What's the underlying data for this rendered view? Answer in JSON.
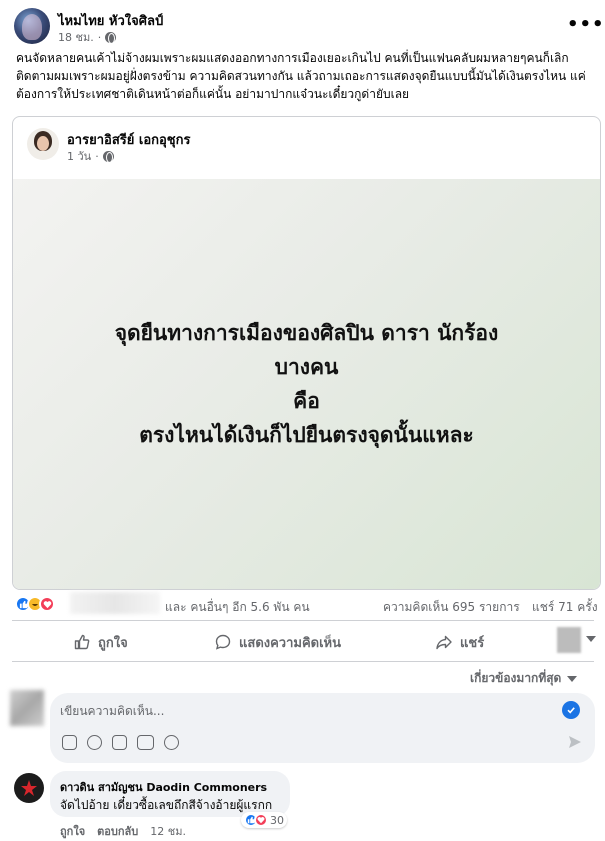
{
  "post": {
    "author": "ไหมไทย หัวใจศิลป์",
    "time": "18 ชม.",
    "more_label": "•••",
    "caption": "คนจัดหลายคนเค้าไม่จ้างผมเพราะผมแสดงออกทางการเมืองเยอะเกินไป คนที่เป็นแฟนคลับผมหลายๆคนก็เลิกติดตามผมเพราะผมอยู่ฝั่งตรงข้าม ความคิดสวนทางกัน แล้วถามเถอะการแสดงจุดยืนแบบนี้มันได้เงินตรงไหน แค่ต้องการให้ประเทศชาติเดินหน้าต่อก็แค่นั้น อย่ามาปากแจ๋วนะเดี๋ยวกูด่ายับเลย"
  },
  "shared": {
    "author": "อารยาอิสรีย์ เอกอุชุกร",
    "time": "1 วัน",
    "quote_lines": [
      "จุดยืนทางการเมืองของศิลปิน ดารา นักร้อง",
      "บางคน",
      "คือ",
      "ตรงไหนได้เงินก็ไปยืนตรงจุดนั้นแหละ"
    ]
  },
  "stats": {
    "reactions_text": "และ คนอื่นๆ อีก 5.6 พัน คน",
    "comments": "ความคิดเห็น 695 รายการ",
    "shares": "แชร์ 71 ครั้ง"
  },
  "actions": {
    "like": "ถูกใจ",
    "comment": "แสดงความคิดเห็น",
    "share": "แชร์"
  },
  "sort_label": "เกี่ยวข้องมากที่สุด",
  "composer": {
    "placeholder": "เขียนความคิดเห็น..."
  },
  "comment": {
    "author": "ดาวดิน สามัญชน Daodin Commoners",
    "text": "จัดไปอ้าย เดี๋ยวซื้อเลขถึกสีจ้างอ้ายผู้แรกก",
    "reaction_count": "30",
    "like_label": "ถูกใจ",
    "reply_label": "ตอบกลับ",
    "time": "12 ชม."
  },
  "colors": {
    "accent": "#1877f2",
    "muted": "#65676b",
    "bubble": "#f0f2f5"
  }
}
